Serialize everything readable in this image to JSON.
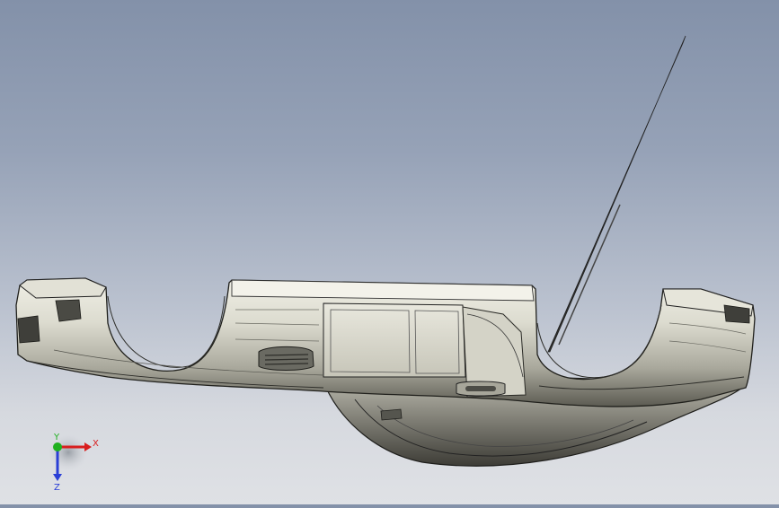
{
  "viewport": {
    "background_top": "#8391a9",
    "background_bottom": "#dfe1e5",
    "model": "dashboard-panel-model"
  },
  "triad": {
    "x_label": "X",
    "y_label": "Y",
    "z_label": "Z",
    "x_color": "#d81e1e",
    "y_color": "#1fb01f",
    "z_color": "#2a3fd6"
  }
}
